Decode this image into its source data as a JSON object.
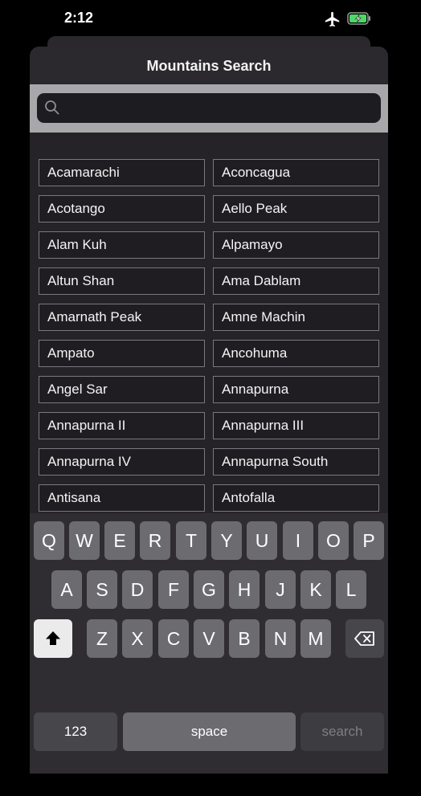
{
  "status_bar": {
    "time": "2:12"
  },
  "nav": {
    "title": "Mountains Search"
  },
  "search": {
    "value": "",
    "placeholder": ""
  },
  "mountains": {
    "left": [
      "Acamarachi",
      "Acotango",
      "Alam Kuh",
      "Altun Shan",
      "Amarnath Peak",
      "Ampato",
      "Angel Sar",
      "Annapurna II",
      "Annapurna IV",
      "Antisana"
    ],
    "right": [
      "Aconcagua",
      "Aello Peak",
      "Alpamayo",
      "Ama Dablam",
      "Amne Machin",
      "Ancohuma",
      "Annapurna",
      "Annapurna III",
      "Annapurna South",
      "Antofalla"
    ]
  },
  "keyboard": {
    "row1": [
      "Q",
      "W",
      "E",
      "R",
      "T",
      "Y",
      "U",
      "I",
      "O",
      "P"
    ],
    "row2": [
      "A",
      "S",
      "D",
      "F",
      "G",
      "H",
      "J",
      "K",
      "L"
    ],
    "row3": [
      "Z",
      "X",
      "C",
      "V",
      "B",
      "N",
      "M"
    ],
    "numbers_label": "123",
    "space_label": "space",
    "search_label": "search"
  },
  "colors": {
    "battery_fill": "#4cd964",
    "sheet_bg": "#232125",
    "search_band": "#a8a8aa"
  }
}
